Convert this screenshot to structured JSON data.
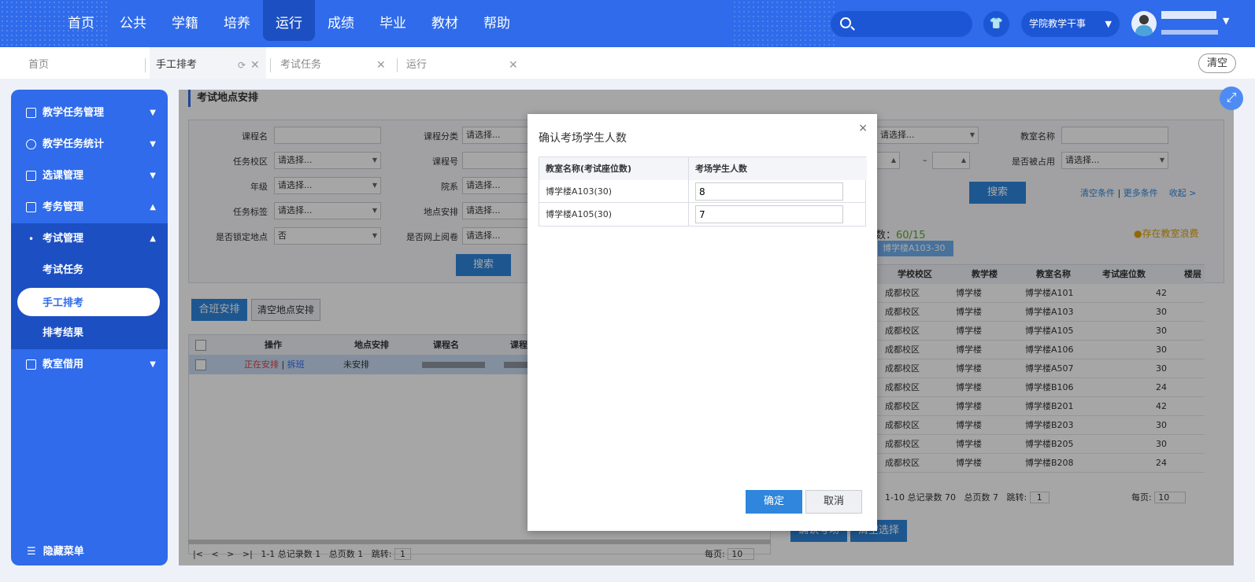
{
  "topnav": {
    "menu": [
      "首页",
      "公共",
      "学籍",
      "培养",
      "运行",
      "成绩",
      "毕业",
      "教材",
      "帮助"
    ],
    "active_index": 4,
    "role": "学院教学干事",
    "shirt_icon": "shirt-icon"
  },
  "tabs": {
    "items": [
      {
        "label": "首页"
      },
      {
        "label": "手工排考"
      },
      {
        "label": "考试任务"
      },
      {
        "label": "运行"
      }
    ],
    "clear_label": "清空"
  },
  "sidebar": {
    "items": [
      {
        "label": "教学任务管理",
        "chev": "⌄"
      },
      {
        "label": "教学任务统计",
        "chev": "⌄"
      },
      {
        "label": "选课管理",
        "chev": "⌄"
      },
      {
        "label": "考务管理",
        "chev": "⌃"
      }
    ],
    "sub_label": "考试管理",
    "sub_children": [
      "考试任务",
      "手工排考",
      "排考结果"
    ],
    "last_item": "教室借用",
    "hide_label": "隐藏菜单"
  },
  "main": {
    "title": "考试地点安排",
    "form": {
      "labels_col1": [
        "课程名",
        "任务校区",
        "年级",
        "任务标签",
        "是否锁定地点"
      ],
      "values_col1": [
        "",
        "请选择...",
        "请选择...",
        "请选择...",
        "否"
      ],
      "labels_col2": [
        "课程分类",
        "课程号",
        "院系",
        "地点安排",
        "是否网上阅卷"
      ],
      "values_col2": [
        "请选择...",
        "",
        "请选择...",
        "请选择...",
        "请选择..."
      ],
      "right_select": "请选择...",
      "classroom_label": "教室名称",
      "occupied_label": "是否被占用",
      "occupied_value": "请选择...",
      "dash": "–",
      "search_label": "搜索",
      "search_label2": "搜索",
      "clear_cond": "清空条件",
      "pipe": "|",
      "more_cond": "更多条件",
      "collapse": "收起 >"
    },
    "merge_btn": "合班安排",
    "clear_btn": "清空地点安排",
    "left_grid": {
      "headers": [
        "操作",
        "地点安排",
        "课程名",
        "课程"
      ],
      "row": {
        "op_a": "正在安排",
        "op_sep": "|",
        "op_b": "拆班",
        "place": "未安排"
      },
      "pager": {
        "info": "1-1 总记录数 1",
        "pages": "总页数 1",
        "jump": "跳转:",
        "jump_val": "1",
        "per": "每页:",
        "per_val": "10"
      },
      "pager_icons": [
        "|<",
        "<",
        ">",
        ">|"
      ]
    },
    "right": {
      "count_prefix": "数：",
      "count": "60/15",
      "warn": "存在教室浪费",
      "tag": "博学楼A103-30 ✕",
      "headers": [
        "学校校区",
        "教学楼",
        "教室名称",
        "考试座位数",
        "楼层"
      ],
      "rows": [
        [
          "成都校区",
          "博学楼",
          "博学楼A101",
          "42"
        ],
        [
          "成都校区",
          "博学楼",
          "博学楼A103",
          "30"
        ],
        [
          "成都校区",
          "博学楼",
          "博学楼A105",
          "30"
        ],
        [
          "成都校区",
          "博学楼",
          "博学楼A106",
          "30"
        ],
        [
          "成都校区",
          "博学楼",
          "博学楼A507",
          "30"
        ],
        [
          "成都校区",
          "博学楼",
          "博学楼B106",
          "24"
        ],
        [
          "成都校区",
          "博学楼",
          "博学楼B201",
          "42"
        ],
        [
          "成都校区",
          "博学楼",
          "博学楼B203",
          "30"
        ],
        [
          "成都校区",
          "博学楼",
          "博学楼B205",
          "30"
        ],
        [
          "成都校区",
          "博学楼",
          "博学楼B208",
          "24"
        ]
      ],
      "pager": {
        "info": "1-10 总记录数 70",
        "pages": "总页数 7",
        "jump": "跳转:",
        "jump_val": "1",
        "per": "每页:",
        "per_val": "10"
      },
      "confirm_btn": "确认考场",
      "clear_sel": "清空选择"
    }
  },
  "modal": {
    "title": "确认考场学生人数",
    "col1": "教室名称(考试座位数)",
    "col2": "考场学生人数",
    "rows": [
      {
        "room": "博学楼A103(30)",
        "count": "8"
      },
      {
        "room": "博学楼A105(30)",
        "count": "7"
      }
    ],
    "ok": "确定",
    "cancel": "取消",
    "close": "×"
  }
}
